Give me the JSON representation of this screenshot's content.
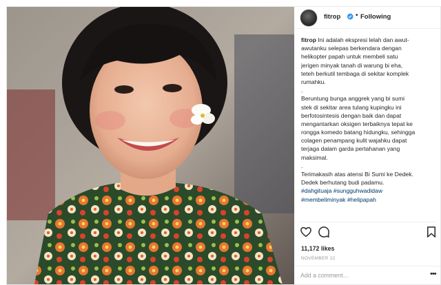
{
  "post": {
    "username": "fitrop",
    "follow_status": "Following",
    "separator": "•",
    "caption_username": "fitrop",
    "caption_lines": [
      "Ini adalah ekspresi lelah dan awut-",
      "awutanku selepas berkendara dengan",
      "helikopter papah untuk membeli satu",
      "jerigen minyak tanah di warung bi eha,",
      "teteh berkutil tembaga di sekitar komplek",
      "rumahku.",
      ".",
      "Beruntung bunga anggrek yang bi sumi",
      "stek di sekitar area tulang kupingku ini",
      "berfotosintesis dengan baik dan dapat",
      "mengantarkan oksigen terbaiknya tepat ke",
      "rongga komedo batang hidungku, sehingga",
      "colagen penampang kulit wajahku dapat",
      "terjaga dalam garda pertahanan yang",
      "maksimal.",
      ".",
      "Terimakasih atas atensi Bi Sumi ke Dedek.",
      "Dedek berhutang budi padamu."
    ],
    "hashtags_line1": "#dahgituaja #sungguhwadidaw",
    "hashtags_line2": "#membeliminyak #helipapah",
    "likes": "11,172 likes",
    "date": "NOVEMBER 22",
    "comment_placeholder": "Add a comment…",
    "more_label": "•••"
  },
  "icons": {
    "like": "heart-outline-icon",
    "comment": "speech-bubble-icon",
    "save": "bookmark-icon",
    "verified": "verified-badge-icon",
    "more": "more-options-icon"
  },
  "colors": {
    "verified": "#3897f0",
    "hashtag": "#003569",
    "muted": "#999999",
    "text": "#262626"
  }
}
